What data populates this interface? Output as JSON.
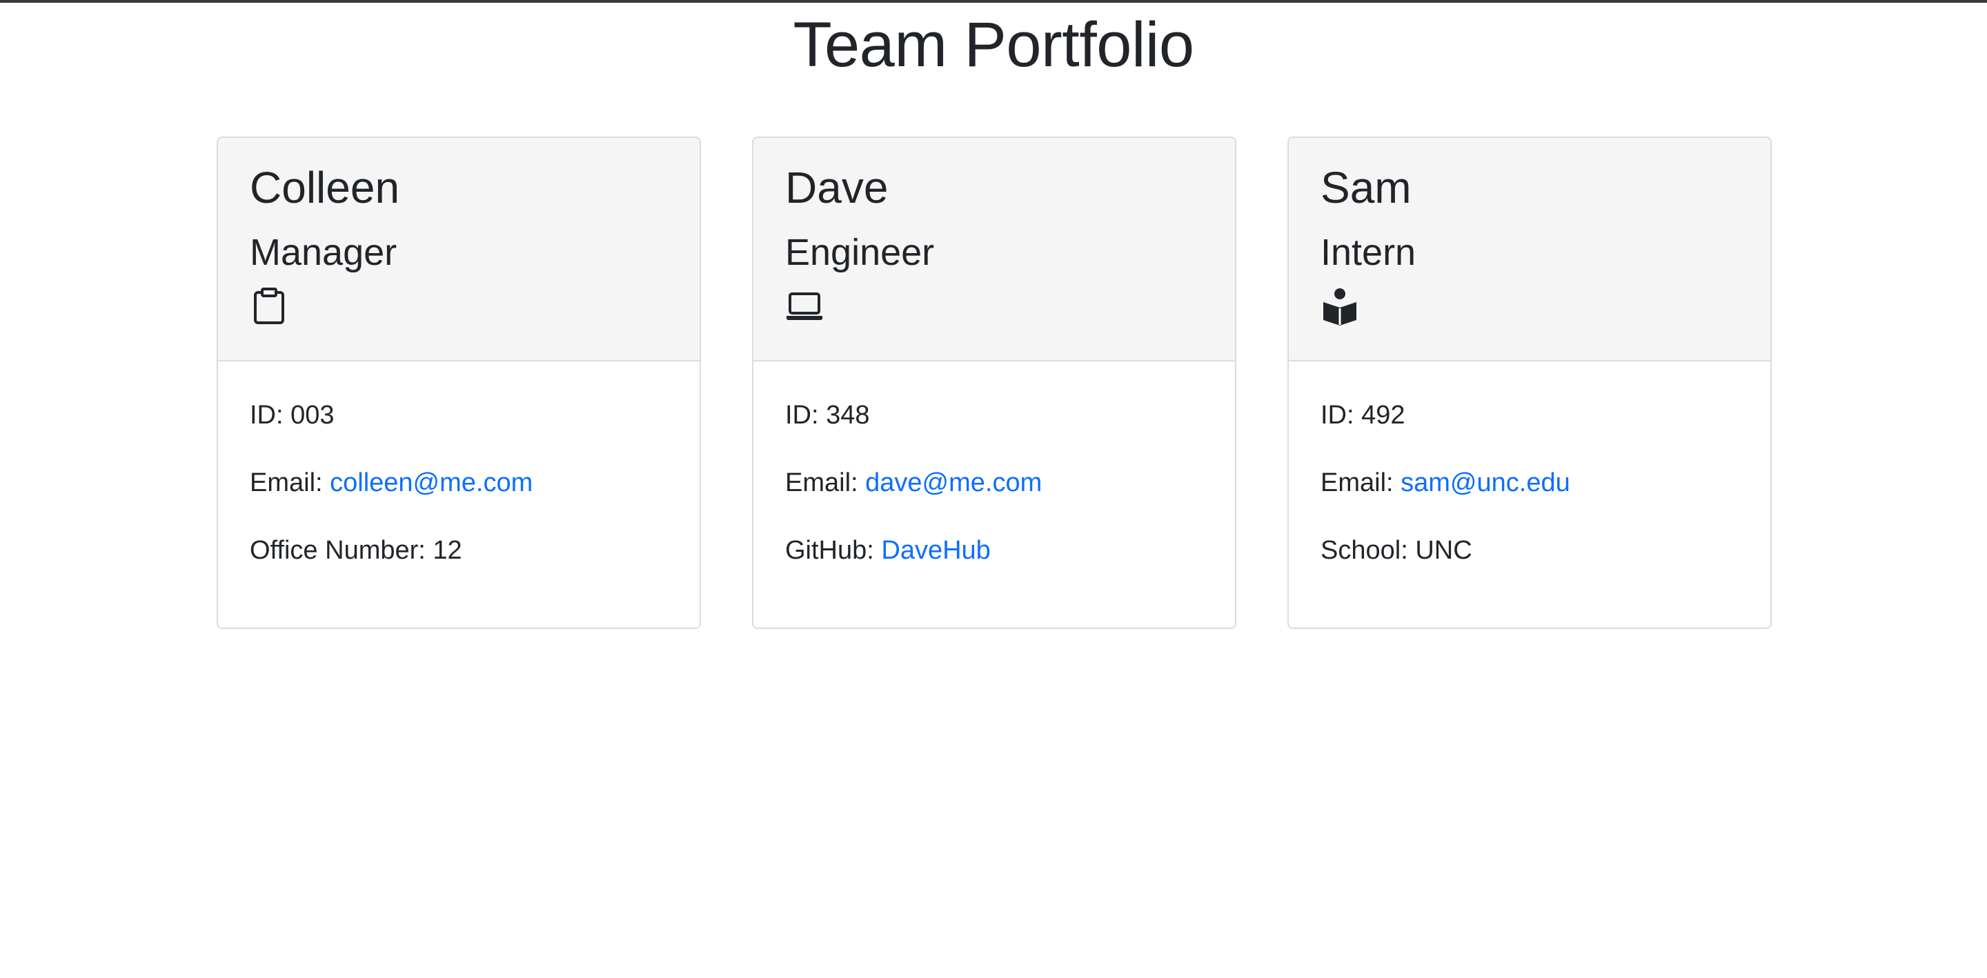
{
  "page": {
    "title": "Team Portfolio"
  },
  "colors": {
    "link": "#0d6efd",
    "card_header_bg": "#f5f5f5",
    "text": "#212529"
  },
  "employees": [
    {
      "name": "Colleen",
      "role": "Manager",
      "icon": "clipboard-icon",
      "id_label": "ID: ",
      "id": "003",
      "email_label": "Email: ",
      "email": "colleen@me.com",
      "extra_label": "Office Number: ",
      "extra_value": "12"
    },
    {
      "name": "Dave",
      "role": "Engineer",
      "icon": "laptop-icon",
      "id_label": "ID: ",
      "id": "348",
      "email_label": "Email: ",
      "email": "dave@me.com",
      "extra_label": "GitHub: ",
      "extra_value": "DaveHub"
    },
    {
      "name": "Sam",
      "role": "Intern",
      "icon": "reader-icon",
      "id_label": "ID: ",
      "id": "492",
      "email_label": "Email: ",
      "email": "sam@unc.edu",
      "extra_label": "School: ",
      "extra_value": "UNC"
    }
  ]
}
